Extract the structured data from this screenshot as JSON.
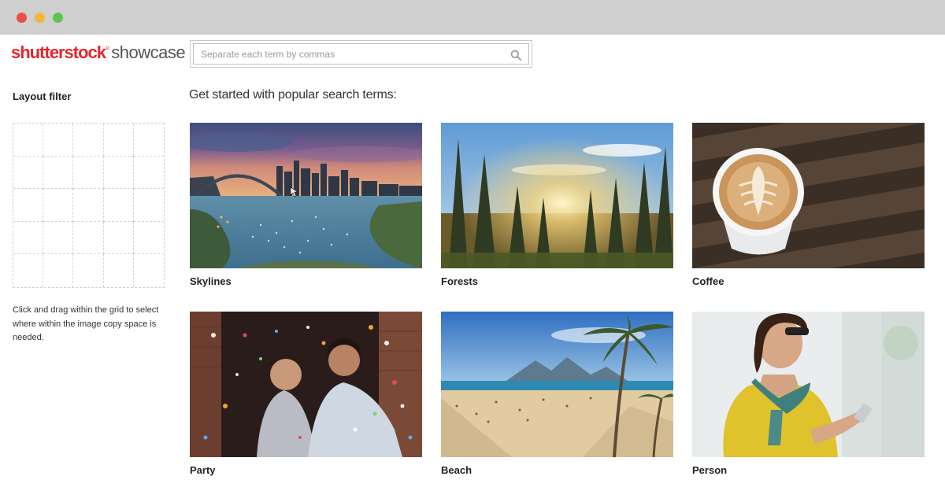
{
  "window": {
    "controls": [
      "close",
      "minimize",
      "maximize"
    ]
  },
  "header": {
    "logo_brand": "shutterstock",
    "logo_tm": "®",
    "logo_product": "showcase",
    "search_placeholder": "Separate each term by commas",
    "search_value": ""
  },
  "sidebar": {
    "filter_title": "Layout filter",
    "grid_rows": 5,
    "grid_cols": 5,
    "help_text": "Click and drag within the grid to select where within the image copy space is needed."
  },
  "main": {
    "heading": "Get started with popular search terms:",
    "cards": [
      {
        "label": "Skylines",
        "image": "sydney-harbour-skyline-photo"
      },
      {
        "label": "Forests",
        "image": "pine-forest-sunburst-photo"
      },
      {
        "label": "Coffee",
        "image": "latte-cup-on-wood-photo"
      },
      {
        "label": "Party",
        "image": "two-men-confetti-party-photo"
      },
      {
        "label": "Beach",
        "image": "tropical-beach-palm-photo"
      },
      {
        "label": "Person",
        "image": "woman-with-phone-photo"
      }
    ]
  },
  "colors": {
    "brand_red": "#e4262e",
    "titlebar": "#cfcfcf",
    "text": "#222222"
  }
}
